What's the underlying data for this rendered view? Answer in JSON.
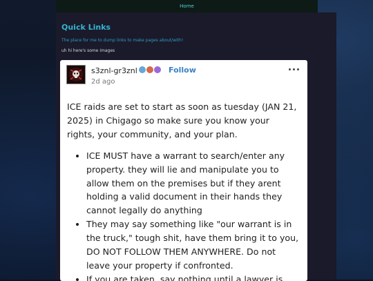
{
  "nav": {
    "home_label": "Home"
  },
  "quick_links": {
    "title": "Quick Links",
    "subtitle": "The place for me to dump links to make pages about/with!",
    "note": "uh hi here's some images"
  },
  "post": {
    "username": "s3znl-gr3znl",
    "follow_label": "Follow",
    "timestamp": "2d ago",
    "intro": "ICE raids are set to start as soon as tuesday (JAN 21, 2025) in Chigago so make sure you know your rights, your community, and your plan.",
    "bullets": [
      "ICE MUST have a warrant to search/enter any property. they will lie and manipulate you to allow them on the premises but if they arent holding a valid document in their hands they cannot legally do anything",
      "They may say something like \"our warrant is in the truck,\" tough shit, have them bring it to you, DO NOT FOLLOW THEM ANYWHERE. Do not leave your property if confronted.",
      "If you are taken, say nothing until a lawyer is"
    ],
    "badge_colors": [
      "#6aa6d8",
      "#d46a4a",
      "#9b6ad8"
    ]
  },
  "colors": {
    "accent": "#33b4d0",
    "follow": "#3b82c4",
    "background": "#0c1424"
  },
  "icons": {
    "avatar": "skull-avatar-icon",
    "more": "more-options-icon"
  }
}
